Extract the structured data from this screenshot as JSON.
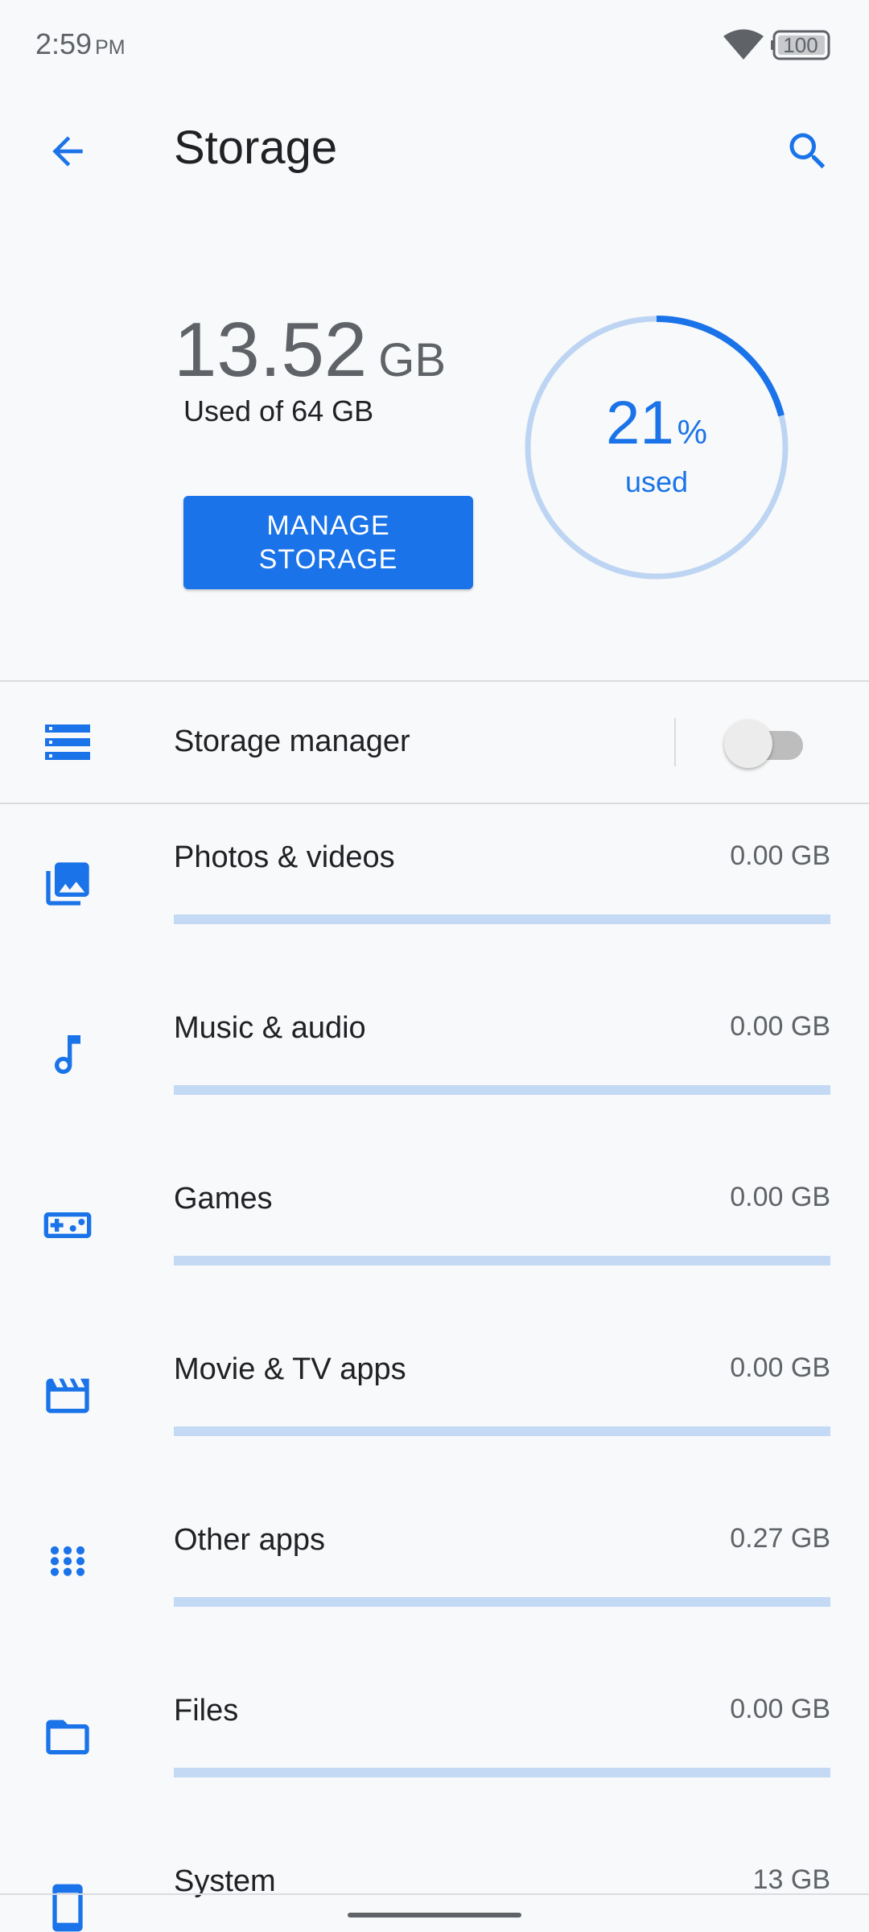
{
  "status_bar": {
    "time": "2:59",
    "ampm": "PM",
    "battery": "100"
  },
  "header": {
    "title": "Storage",
    "back_icon": "arrow-back-icon",
    "search_icon": "search-icon"
  },
  "summary": {
    "used_value": "13.52",
    "used_unit": "GB",
    "used_of": "Used of 64 GB",
    "manage_label": "MANAGE STORAGE",
    "percent": "21",
    "percent_symbol": "%",
    "percent_caption": "used",
    "used_fraction": 0.21
  },
  "storage_manager": {
    "label": "Storage manager",
    "icon": "storage-manager-icon",
    "enabled": false
  },
  "categories": [
    {
      "label": "Photos & videos",
      "size": "0.00 GB",
      "icon": "photo-library-icon",
      "fraction": 0.0
    },
    {
      "label": "Music & audio",
      "size": "0.00 GB",
      "icon": "music-note-icon",
      "fraction": 0.0
    },
    {
      "label": "Games",
      "size": "0.00 GB",
      "icon": "gamepad-icon",
      "fraction": 0.0
    },
    {
      "label": "Movie & TV apps",
      "size": "0.00 GB",
      "icon": "movie-clapper-icon",
      "fraction": 0.0
    },
    {
      "label": "Other apps",
      "size": "0.27 GB",
      "icon": "apps-grid-icon",
      "fraction": 0.0
    },
    {
      "label": "Files",
      "size": "0.00 GB",
      "icon": "folder-icon",
      "fraction": 0.0
    },
    {
      "label": "System",
      "size": "13 GB",
      "icon": "system-icon",
      "fraction": 0.0
    }
  ],
  "colors": {
    "accent": "#1a73e8",
    "ring_track": "#bdd5f3",
    "bar_track": "#c3d9f4",
    "background": "#f8f9fa"
  }
}
